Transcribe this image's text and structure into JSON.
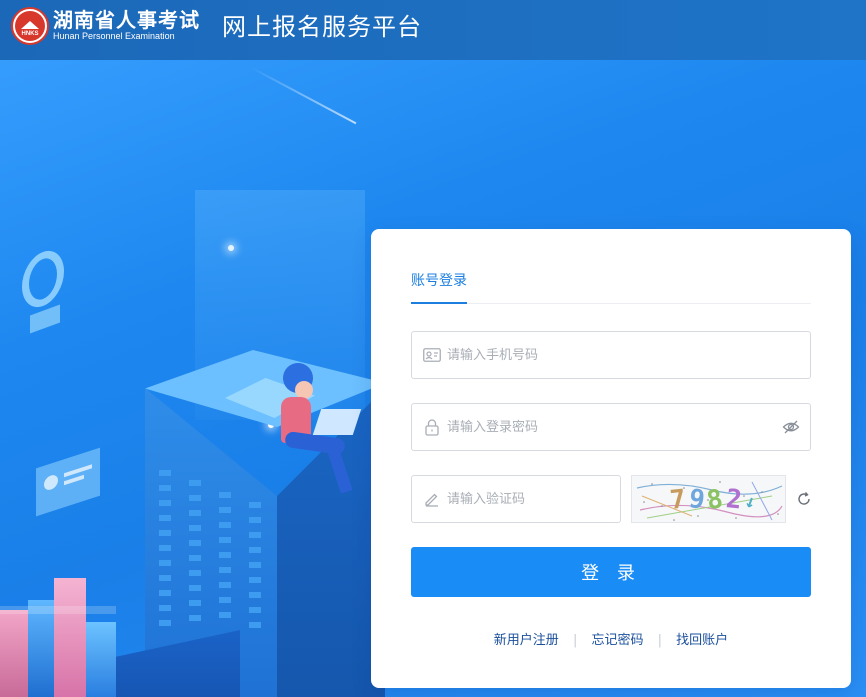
{
  "header": {
    "logo_abbr": "HNKS",
    "logo_cn": "湖南省人事考试",
    "logo_en": "Hunan Personnel Examination",
    "platform_title": "网上报名服务平台"
  },
  "login": {
    "tab_label": "账号登录",
    "phone_placeholder": "请输入手机号码",
    "password_placeholder": "请输入登录密码",
    "code_placeholder": "请输入验证码",
    "captcha_digits": [
      "7",
      "9",
      "8",
      "2",
      "↓"
    ],
    "submit_label": "登 录",
    "links": {
      "register": "新用户注册",
      "forgot": "忘记密码",
      "recover": "找回账户",
      "separator": "|"
    }
  },
  "icons": {
    "logo": "hnks-emblem-icon",
    "phone": "id-card-icon",
    "password": "lock-icon",
    "visibility": "eye-off-icon",
    "code": "pen-icon",
    "refresh": "refresh-icon"
  },
  "colors": {
    "header_bg": "#1c68b8",
    "accent": "#1a8cf5",
    "tab_active": "#1c7fe0",
    "link": "#1a4f9c",
    "logo_red": "#d8372c"
  }
}
